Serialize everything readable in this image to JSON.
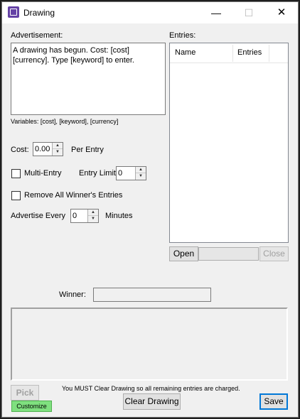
{
  "window": {
    "title": "Drawing",
    "minimize_glyph": "—",
    "maximize_glyph": "☐",
    "close_glyph": "✕"
  },
  "advertisement": {
    "label": "Advertisement:",
    "text": "A drawing has begun. Cost: [cost] [currency]. Type [keyword] to enter.",
    "variables": "Variables: [cost], [keyword], [currency]"
  },
  "cost": {
    "label": "Cost:",
    "value": "0.00",
    "suffix": "Per Entry"
  },
  "multi_entry": {
    "label": "Multi-Entry",
    "checked": false
  },
  "entry_limit": {
    "label": "Entry Limit:",
    "value": "0"
  },
  "remove_winner_entries": {
    "label": "Remove All Winner's Entries",
    "checked": false
  },
  "advertise": {
    "label": "Advertise Every",
    "value": "0",
    "suffix": "Minutes"
  },
  "entries": {
    "label": "Entries:",
    "columns": [
      "Name",
      "Entries"
    ],
    "rows": []
  },
  "open_button": "Open",
  "close_button": "Close",
  "winner": {
    "label": "Winner:",
    "value": ""
  },
  "pick_button": "Pick",
  "customize_button": "Customize",
  "notice": "You MUST Clear Drawing so all remaining entries are charged.",
  "clear_drawing_button": "Clear Drawing",
  "save_button": "Save",
  "colors": {
    "accent": "#6441a5",
    "customize_bg": "#7fe07f",
    "focus_border": "#0078d7"
  }
}
